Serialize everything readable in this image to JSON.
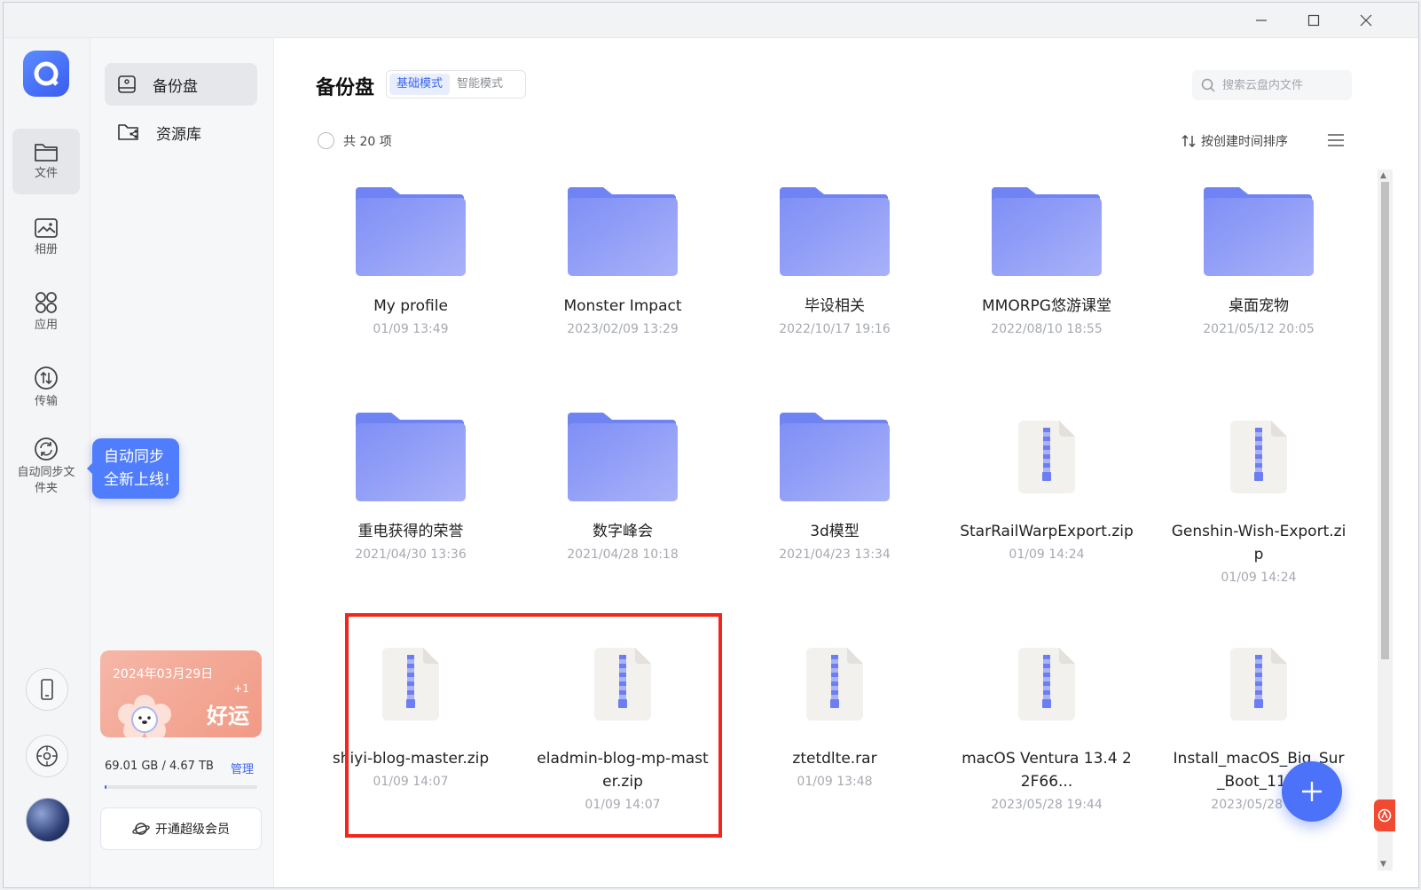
{
  "window": {
    "minimize_icon": "minimize-icon",
    "maximize_icon": "maximize-icon",
    "close_icon": "close-icon"
  },
  "rail": {
    "items": [
      {
        "label": "文件",
        "icon": "folder-icon",
        "active": true
      },
      {
        "label": "相册",
        "icon": "photo-icon",
        "active": false
      },
      {
        "label": "应用",
        "icon": "apps-icon",
        "active": false
      },
      {
        "label": "传输",
        "icon": "transfer-icon",
        "active": false
      },
      {
        "label": "自动同步文件夹",
        "icon": "sync-icon",
        "active": false
      }
    ],
    "bottom_icons": [
      "phone-icon",
      "settings-icon",
      "avatar"
    ]
  },
  "tooltip": {
    "line1": "自动同步",
    "line2": "全新上线!"
  },
  "sidebar": {
    "items": [
      {
        "label": "备份盘",
        "icon": "backup-drive-icon",
        "active": true
      },
      {
        "label": "资源库",
        "icon": "shared-folder-icon",
        "active": false
      }
    ],
    "promo": {
      "date": "2024年03月29日",
      "plus": "+1",
      "luck": "好运"
    },
    "storage": {
      "used": "69.01 GB / 4.67 TB",
      "manage": "管理",
      "fraction": 0.014
    },
    "vip_button": "开通超级会员"
  },
  "main": {
    "title": "备份盘",
    "modes": [
      "基础模式",
      "智能模式"
    ],
    "active_mode": "基础模式",
    "search_placeholder": "搜索云盘内文件",
    "count": "共 20 项",
    "sort_label": "按创建时间排序"
  },
  "files": [
    {
      "name": "My profile",
      "time": "01/09 13:49",
      "type": "folder"
    },
    {
      "name": "Monster Impact",
      "time": "2023/02/09 13:29",
      "type": "folder"
    },
    {
      "name": "毕设相关",
      "time": "2022/10/17 19:16",
      "type": "folder"
    },
    {
      "name": "MMORPG悠游课堂",
      "time": "2022/08/10 18:55",
      "type": "folder"
    },
    {
      "name": "桌面宠物",
      "time": "2021/05/12 20:05",
      "type": "folder"
    },
    {
      "name": "重电获得的荣誉",
      "time": "2021/04/30 13:36",
      "type": "folder"
    },
    {
      "name": "数字峰会",
      "time": "2021/04/28 10:18",
      "type": "folder"
    },
    {
      "name": "3d模型",
      "time": "2021/04/23 13:34",
      "type": "folder"
    },
    {
      "name": "StarRailWarpExport.zip",
      "time": "01/09 14:24",
      "type": "zip"
    },
    {
      "name": "Genshin-Wish-Export.zip",
      "time": "01/09 14:24",
      "type": "zip"
    },
    {
      "name": "shiyi-blog-master.zip",
      "time": "01/09 14:07",
      "type": "zip"
    },
    {
      "name": "eladmin-blog-mp-master.zip",
      "time": "01/09 14:07",
      "type": "zip"
    },
    {
      "name": "ztetdlte.rar",
      "time": "01/09 13:48",
      "type": "zip"
    },
    {
      "name": "macOS Ventura 13.4 22F66...",
      "time": "2023/05/28 19:44",
      "type": "zip"
    },
    {
      "name": "Install_macOS_Big_Sur_Boot_11...",
      "time": "2023/05/28 1...",
      "type": "zip"
    }
  ],
  "colors": {
    "accent": "#3a64f0",
    "folder": "#8a9cf7",
    "highlight": "#f2261c"
  }
}
